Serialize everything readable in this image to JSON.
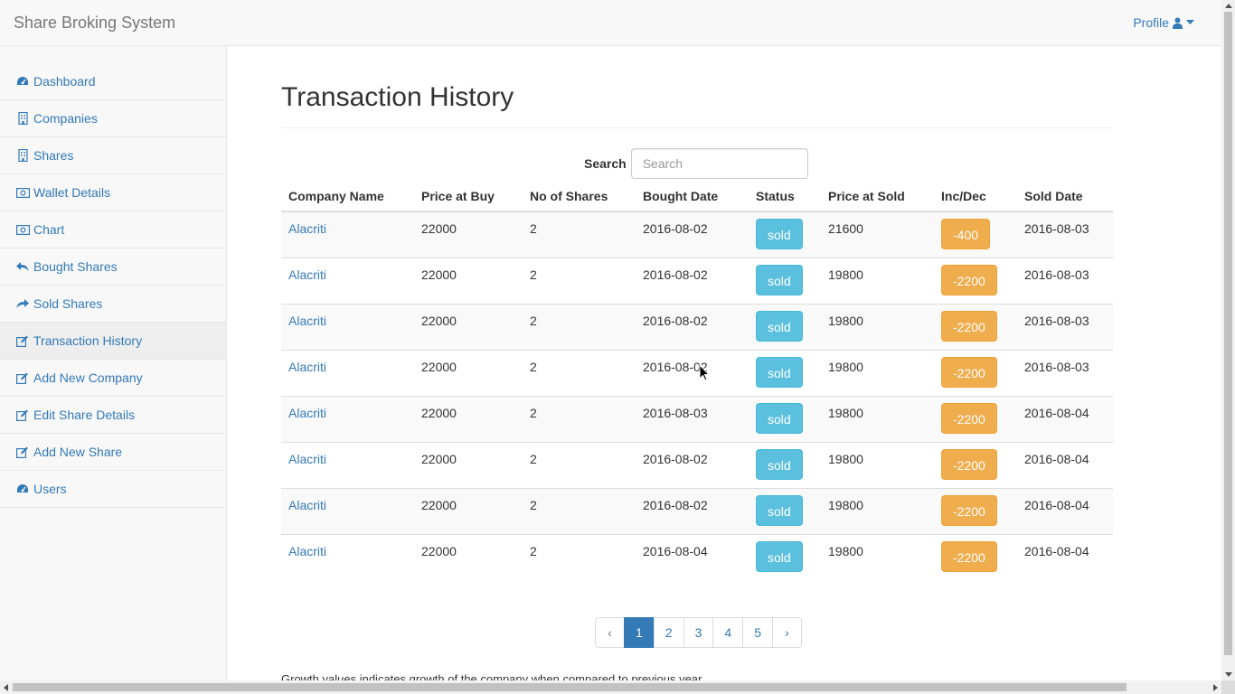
{
  "navbar": {
    "brand": "Share Broking System",
    "profile_label": "Profile"
  },
  "sidebar": {
    "items": [
      {
        "label": "Dashboard",
        "icon": "dashboard-icon"
      },
      {
        "label": "Companies",
        "icon": "building-icon"
      },
      {
        "label": "Shares",
        "icon": "building-icon"
      },
      {
        "label": "Wallet Details",
        "icon": "money-icon"
      },
      {
        "label": "Chart",
        "icon": "money-icon"
      },
      {
        "label": "Bought Shares",
        "icon": "reply-icon"
      },
      {
        "label": "Sold Shares",
        "icon": "share-icon"
      },
      {
        "label": "Transaction History",
        "icon": "edit-icon"
      },
      {
        "label": "Add New Company",
        "icon": "edit-icon"
      },
      {
        "label": "Edit Share Details",
        "icon": "edit-icon"
      },
      {
        "label": "Add New Share",
        "icon": "edit-icon"
      },
      {
        "label": "Users",
        "icon": "dashboard-icon"
      }
    ]
  },
  "page": {
    "title": "Transaction History",
    "search_label": "Search",
    "search_placeholder": "Search",
    "footnote": "Growth values indicates growth of the company when compared to previous year"
  },
  "table": {
    "headers": [
      "Company Name",
      "Price at Buy",
      "No of Shares",
      "Bought Date",
      "Status",
      "Price at Sold",
      "Inc/Dec",
      "Sold Date"
    ],
    "rows": [
      {
        "company": "Alacriti",
        "buy": "22000",
        "shares": "2",
        "bought": "2016-08-02",
        "status": "sold",
        "sold_price": "21600",
        "incdec": "-400",
        "sold_date": "2016-08-03"
      },
      {
        "company": "Alacriti",
        "buy": "22000",
        "shares": "2",
        "bought": "2016-08-02",
        "status": "sold",
        "sold_price": "19800",
        "incdec": "-2200",
        "sold_date": "2016-08-03"
      },
      {
        "company": "Alacriti",
        "buy": "22000",
        "shares": "2",
        "bought": "2016-08-02",
        "status": "sold",
        "sold_price": "19800",
        "incdec": "-2200",
        "sold_date": "2016-08-03"
      },
      {
        "company": "Alacriti",
        "buy": "22000",
        "shares": "2",
        "bought": "2016-08-02",
        "status": "sold",
        "sold_price": "19800",
        "incdec": "-2200",
        "sold_date": "2016-08-03"
      },
      {
        "company": "Alacriti",
        "buy": "22000",
        "shares": "2",
        "bought": "2016-08-03",
        "status": "sold",
        "sold_price": "19800",
        "incdec": "-2200",
        "sold_date": "2016-08-04"
      },
      {
        "company": "Alacriti",
        "buy": "22000",
        "shares": "2",
        "bought": "2016-08-02",
        "status": "sold",
        "sold_price": "19800",
        "incdec": "-2200",
        "sold_date": "2016-08-04"
      },
      {
        "company": "Alacriti",
        "buy": "22000",
        "shares": "2",
        "bought": "2016-08-02",
        "status": "sold",
        "sold_price": "19800",
        "incdec": "-2200",
        "sold_date": "2016-08-04"
      },
      {
        "company": "Alacriti",
        "buy": "22000",
        "shares": "2",
        "bought": "2016-08-04",
        "status": "sold",
        "sold_price": "19800",
        "incdec": "-2200",
        "sold_date": "2016-08-04"
      }
    ]
  },
  "pagination": {
    "prev": "‹",
    "pages": [
      "1",
      "2",
      "3",
      "4",
      "5"
    ],
    "next": "›",
    "active_page": "1"
  },
  "colors": {
    "link": "#337ab7",
    "status_info": "#5bc0de",
    "incdec_warning": "#f0ad4e"
  }
}
